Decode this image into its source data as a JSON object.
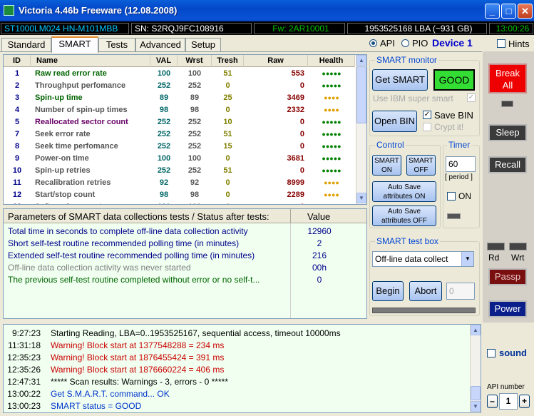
{
  "window": {
    "title": "Victoria 4.46b Freeware (12.08.2008)"
  },
  "infobar": {
    "model": "ST1000LM024 HN-M101MBB",
    "serial": "SN: S2RQJ9FC108916",
    "firmware": "Fw: 2AR10001",
    "lba": "1953525168 LBA (~931 GB)",
    "time": "13:00:26"
  },
  "tabs": [
    "Standard",
    "SMART",
    "Tests",
    "Advanced",
    "Setup"
  ],
  "mode": {
    "api": "API",
    "pio": "PIO",
    "device": "Device 1",
    "hints": "Hints"
  },
  "smart_table": {
    "headers": [
      "ID",
      "Name",
      "VAL",
      "Wrst",
      "Tresh",
      "Raw",
      "Health"
    ],
    "rows": [
      {
        "id": "1",
        "name": "Raw read error rate",
        "val": "100",
        "wrst": "100",
        "tresh": "51",
        "raw": "553",
        "health": "●●●●●",
        "name_color": "#006400",
        "health_color": "#008000"
      },
      {
        "id": "2",
        "name": "Throughput perfomance",
        "val": "252",
        "wrst": "252",
        "tresh": "0",
        "raw": "0",
        "health": "●●●●●",
        "name_color": "#555555",
        "health_color": "#008000"
      },
      {
        "id": "3",
        "name": "Spin-up time",
        "val": "89",
        "wrst": "89",
        "tresh": "25",
        "raw": "3469",
        "health": "●●●●",
        "name_color": "#006400",
        "health_color": "#e0a000"
      },
      {
        "id": "4",
        "name": "Number of spin-up times",
        "val": "98",
        "wrst": "98",
        "tresh": "0",
        "raw": "2332",
        "health": "●●●●",
        "name_color": "#555555",
        "health_color": "#e0a000"
      },
      {
        "id": "5",
        "name": "Reallocated sector count",
        "val": "252",
        "wrst": "252",
        "tresh": "10",
        "raw": "0",
        "health": "●●●●●",
        "name_color": "#660066",
        "health_color": "#008000"
      },
      {
        "id": "7",
        "name": "Seek error rate",
        "val": "252",
        "wrst": "252",
        "tresh": "51",
        "raw": "0",
        "health": "●●●●●",
        "name_color": "#555555",
        "health_color": "#008000"
      },
      {
        "id": "8",
        "name": "Seek time perfomance",
        "val": "252",
        "wrst": "252",
        "tresh": "15",
        "raw": "0",
        "health": "●●●●●",
        "name_color": "#555555",
        "health_color": "#008000"
      },
      {
        "id": "9",
        "name": "Power-on time",
        "val": "100",
        "wrst": "100",
        "tresh": "0",
        "raw": "3681",
        "health": "●●●●●",
        "name_color": "#555555",
        "health_color": "#008000"
      },
      {
        "id": "10",
        "name": "Spin-up retries",
        "val": "252",
        "wrst": "252",
        "tresh": "51",
        "raw": "0",
        "health": "●●●●●",
        "name_color": "#555555",
        "health_color": "#008000"
      },
      {
        "id": "11",
        "name": "Recalibration retries",
        "val": "92",
        "wrst": "92",
        "tresh": "0",
        "raw": "8999",
        "health": "●●●●",
        "name_color": "#555555",
        "health_color": "#e0a000"
      },
      {
        "id": "12",
        "name": "Start/stop count",
        "val": "98",
        "wrst": "98",
        "tresh": "0",
        "raw": "2289",
        "health": "●●●●",
        "name_color": "#555555",
        "health_color": "#e0a000"
      },
      {
        "id": "13",
        "name": "Soft read error rate",
        "val": "100",
        "wrst": "100",
        "tresh": "0",
        "raw": "0",
        "health": "●●●●●",
        "name_color": "#555555",
        "health_color": "#008000"
      }
    ]
  },
  "params": {
    "header": "Parameters of SMART data collections tests / Status after tests:",
    "value_header": "Value",
    "rows": [
      {
        "text": "Total time in seconds to complete off-line data collection activity",
        "value": "12960",
        "color": "#00008b"
      },
      {
        "text": "Short self-test routine recommended polling time (in minutes)",
        "value": "2",
        "color": "#00008b"
      },
      {
        "text": "Extended self-test routine recommended polling time (in minutes)",
        "value": "216",
        "color": "#00008b"
      },
      {
        "text": "Off-line data collection activity was never started",
        "value": "00h",
        "color": "#808080"
      },
      {
        "text": "The previous self-test routine completed without error or no self-t...",
        "value": "0",
        "color": "#006400"
      }
    ]
  },
  "smart_monitor": {
    "title": "SMART monitor",
    "get_smart": "Get SMART",
    "status": "GOOD",
    "ibm": "Use IBM super smart",
    "open_bin": "Open BIN",
    "save_bin": "Save BIN",
    "crypt": "Crypt it!"
  },
  "control": {
    "title": "Control",
    "smart_on": "SMART ON",
    "smart_off": "SMART OFF",
    "autosave_on": "Auto Save attributes ON",
    "autosave_off": "Auto Save attributes OFF"
  },
  "timer": {
    "title": "Timer",
    "value": "60",
    "period": "[ period ]",
    "on": "ON"
  },
  "testbox": {
    "title": "SMART test box",
    "selected": "Off-line data collect",
    "begin": "Begin",
    "abort": "Abort",
    "number": "0"
  },
  "side": {
    "break_all": "Break All",
    "sleep": "Sleep",
    "recall": "Recall",
    "rd": "Rd",
    "wrt": "Wrt",
    "passp": "Passp",
    "power": "Power",
    "sound": "sound",
    "api_number_label": "API number",
    "api_number": "1",
    "minus": "–",
    "plus": "+"
  },
  "log": [
    {
      "time": "9:27:23",
      "text": "Starting Reading, LBA=0..1953525167, sequential access, timeout 10000ms",
      "color": "#000000"
    },
    {
      "time": "11:31:18",
      "text": "Warning! Block start at 1377548288 = 234 ms",
      "color": "#cc0000"
    },
    {
      "time": "12:35:23",
      "text": "Warning! Block start at 1876455424 = 391 ms",
      "color": "#cc0000"
    },
    {
      "time": "12:35:26",
      "text": "Warning! Block start at 1876660224 = 406 ms",
      "color": "#cc0000"
    },
    {
      "time": "12:47:31",
      "text": "***** Scan results: Warnings - 3, errors - 0 *****",
      "color": "#000000"
    },
    {
      "time": "13:00:22",
      "text": "Get S.M.A.R.T. command... OK",
      "color": "#0033cc"
    },
    {
      "time": "13:00:23",
      "text": "SMART status = GOOD",
      "color": "#0033cc"
    }
  ]
}
